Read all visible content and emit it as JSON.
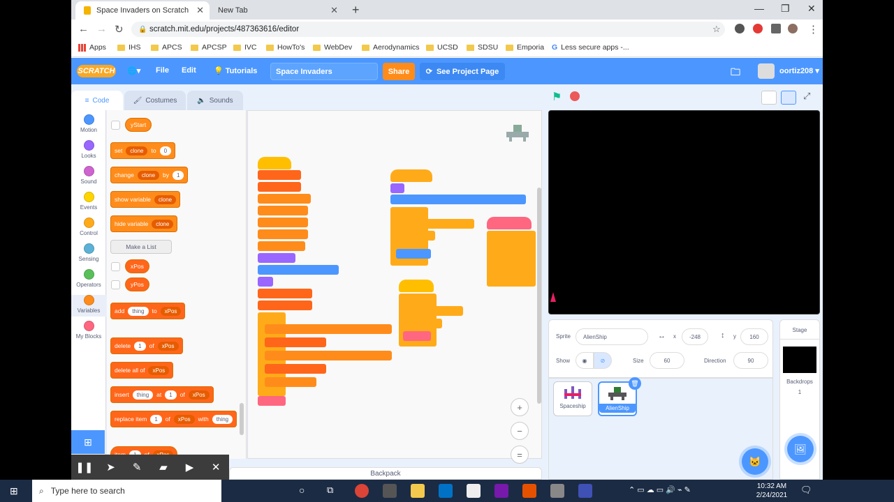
{
  "browser": {
    "tabs": [
      {
        "label": "Space Invaders on Scratch"
      },
      {
        "label": "New Tab"
      }
    ],
    "url": "scratch.mit.edu/projects/487363616/editor",
    "bookmarks": [
      "Apps",
      "IHS",
      "APCS",
      "APCSP",
      "IVC",
      "HowTo's",
      "WebDev",
      "Aerodynamics",
      "UCSD",
      "SDSU",
      "Emporia",
      "Less secure apps -..."
    ]
  },
  "menubar": {
    "logo": "SCRATCH",
    "file": "File",
    "edit": "Edit",
    "tutorials": "Tutorials",
    "project_title": "Space Invaders",
    "share": "Share",
    "see_project": "See Project Page",
    "username": "oortiz208"
  },
  "editor_tabs": {
    "code": "Code",
    "costumes": "Costumes",
    "sounds": "Sounds"
  },
  "categories": [
    {
      "label": "Motion",
      "color": "#4c97ff"
    },
    {
      "label": "Looks",
      "color": "#9966ff"
    },
    {
      "label": "Sound",
      "color": "#cf63cf"
    },
    {
      "label": "Events",
      "color": "#ffd500"
    },
    {
      "label": "Control",
      "color": "#ffab19"
    },
    {
      "label": "Sensing",
      "color": "#5cb1d6"
    },
    {
      "label": "Operators",
      "color": "#59c059"
    },
    {
      "label": "Variables",
      "color": "#ff8c1a"
    },
    {
      "label": "My Blocks",
      "color": "#ff6680"
    }
  ],
  "palette": {
    "ystart": "yStart",
    "set": "set",
    "clone": "clone",
    "to": "to",
    "zero": "0",
    "change": "change",
    "by": "by",
    "one": "1",
    "show_var": "show variable",
    "hide_var": "hide variable",
    "make_list": "Make a List",
    "xpos": "xPos",
    "ypos": "yPos",
    "add": "add",
    "thing": "thing",
    "delete": "delete",
    "of": "of",
    "delete_all": "delete all of",
    "insert": "insert",
    "at": "at",
    "replace": "replace item",
    "with": "with",
    "item": "item"
  },
  "backpack": "Backpack",
  "sprite": {
    "label": "Sprite",
    "name": "AlienShip",
    "x_label": "x",
    "x": "-248",
    "y_label": "y",
    "y": "160",
    "show": "Show",
    "size_label": "Size",
    "size": "60",
    "direction_label": "Direction",
    "direction": "90"
  },
  "sprites": [
    {
      "name": "Spaceship"
    },
    {
      "name": "AlienShip"
    }
  ],
  "stage_panel": {
    "title": "Stage",
    "backdrops": "Backdrops",
    "count": "1"
  },
  "taskbar": {
    "search": "Type here to search",
    "time": "10:32 AM",
    "date": "2/24/2021"
  }
}
